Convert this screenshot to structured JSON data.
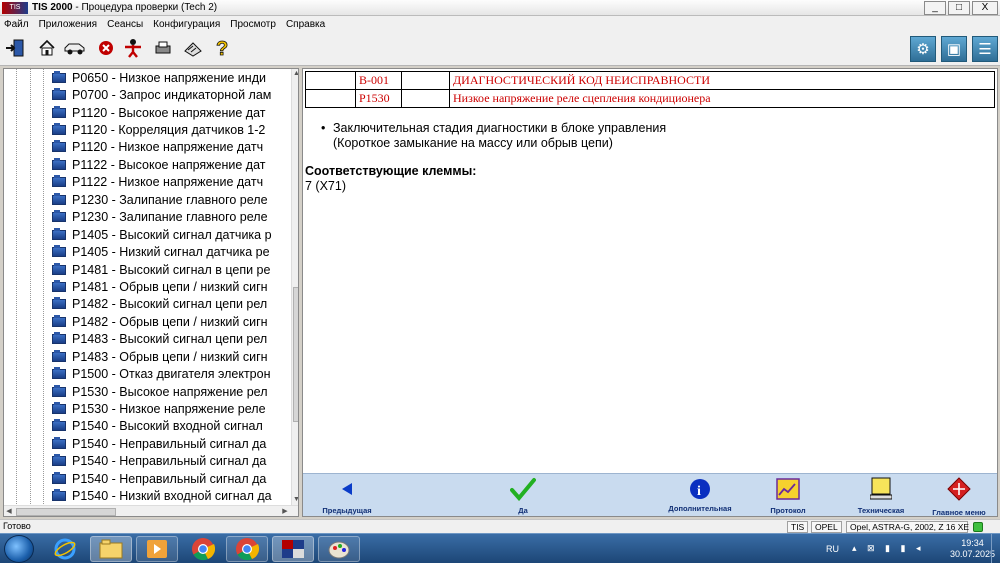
{
  "window": {
    "logo_text": "TIS",
    "app_name": "TIS 2000",
    "title_rest": " - Процедура проверки (Tech 2)",
    "minimize": "_",
    "maximize": "□",
    "close": "X"
  },
  "menu": [
    "Файл",
    "Приложения",
    "Сеансы",
    "Конфигурация",
    "Просмотр",
    "Справка"
  ],
  "toolbar": {
    "left_icons": [
      "exit-icon",
      "home-icon",
      "vehicle-icon",
      "cancel-icon",
      "user-icon",
      "print-icon",
      "notes-icon",
      "help-icon"
    ],
    "right_icons": [
      "tech2-icon",
      "vehicle-select-icon",
      "settings-icon"
    ]
  },
  "tree": {
    "items": [
      "P0650 - Низкое напряжение инди",
      "P0700 - Запрос индикаторной лам",
      "P1120 - Высокое напряжение дат",
      "P1120 - Корреляция датчиков 1-2",
      "P1120 - Низкое напряжение датч",
      "P1122 - Высокое напряжение дат",
      "P1122 - Низкое напряжение датч",
      "P1230 - Залипание главного реле",
      "P1230 - Залипание главного реле",
      "P1405 - Высокий сигнал датчика р",
      "P1405 - Низкий сигнал датчика ре",
      "P1481 - Высокий сигнал в цепи ре",
      "P1481 - Обрыв цепи / низкий сигн",
      "P1482 - Высокий сигнал цепи рел",
      "P1482 - Обрыв цепи / низкий сигн",
      "P1483 - Высокий сигнал цепи рел",
      "P1483 - Обрыв цепи / низкий сигн",
      "P1500 - Отказ двигателя электрон",
      "P1530 - Высокое напряжение рел",
      "P1530 - Низкое напряжение реле",
      "P1540 - Высокий входной сигнал",
      "P1540 - Неправильный сигнал да",
      "P1540 - Неправильный сигнал да",
      "P1540 - Неправильный сигнал да",
      "P1540 - Низкий входной сигнал да"
    ]
  },
  "dtc_table": {
    "rows": [
      {
        "code": "B-001",
        "desc": "ДИАГНОСТИЧЕСКИЙ КОД НЕИСПРАВНОСТИ"
      },
      {
        "code": "P1530",
        "desc": "Низкое напряжение реле сцепления кондиционера"
      }
    ]
  },
  "content": {
    "bullet_line1": "Заключительная стадия диагностики в блоке управления",
    "bullet_line2": "(Короткое замыкание на массу или обрыв цепи)",
    "terminals_heading": "Соответствующие клеммы:",
    "terminals_value": "7 (X71)"
  },
  "navbar": {
    "prev": "Предыдущая",
    "yes": "Да",
    "info": "Дополнительная",
    "protocol": "Протокол",
    "tech": "Техническая",
    "main_menu": "Главное меню"
  },
  "status": {
    "ready": "Готово",
    "tis": "TIS",
    "opel": "OPEL",
    "vehicle": "Opel, ASTRA-G, 2002, Z 16 XE"
  },
  "tray": {
    "lang": "RU",
    "time": "19:34",
    "date": "30.07.2025"
  },
  "colors": {
    "dtc_red": "#cc0000",
    "nav_blue": "#102f75",
    "navbar_bg": "#c9dbef"
  }
}
